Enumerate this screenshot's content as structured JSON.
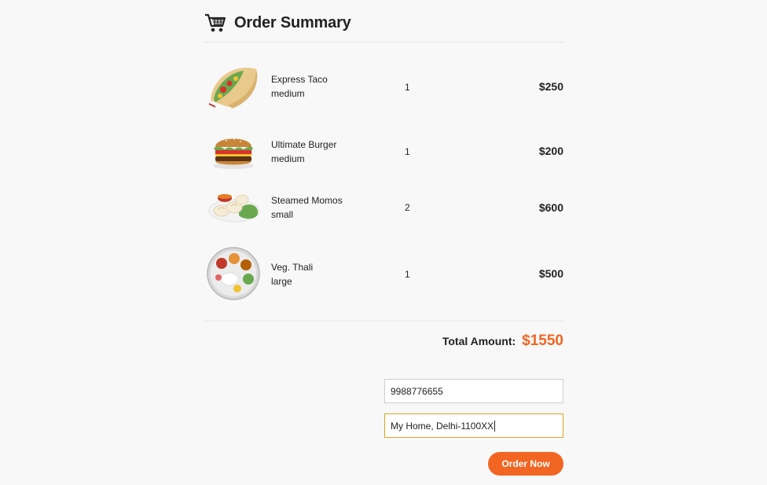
{
  "header": {
    "title": "Order Summary",
    "icon": "cart-icon"
  },
  "items": [
    {
      "name": "Express Taco",
      "size": "medium",
      "qty": "1",
      "price": "$250",
      "image": "taco-image"
    },
    {
      "name": "Ultimate Burger",
      "size": "medium",
      "qty": "1",
      "price": "$200",
      "image": "burger-image"
    },
    {
      "name": "Steamed Momos",
      "size": "small",
      "qty": "2",
      "price": "$600",
      "image": "momos-image"
    },
    {
      "name": "Veg. Thali",
      "size": "large",
      "qty": "1",
      "price": "$500",
      "image": "thali-image"
    }
  ],
  "total": {
    "label": "Total Amount:",
    "value": "$1550"
  },
  "form": {
    "phone_value": "9988776655",
    "address_value": "My Home, Delhi-1100XX"
  },
  "order_button": {
    "label": "Order Now"
  },
  "colors": {
    "accent": "#f26522",
    "focus_border": "#e0a020"
  }
}
